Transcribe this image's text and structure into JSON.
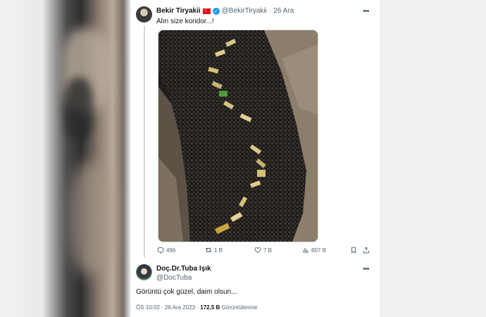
{
  "tweet": {
    "author_name": "Bekir Tiryakii",
    "author_handle": "@BekirTiryakii",
    "separator": "·",
    "date": "26 Ara",
    "text": "Alın size koridor...!",
    "flag_icon": "turkey-flag-icon",
    "verified_icon": "verified-badge-icon",
    "more_label": "•••",
    "stats": {
      "replies": "496",
      "retweets": "1 B",
      "likes": "7 B",
      "views": "807 B"
    }
  },
  "reply": {
    "author_name": "Doç.Dr.Tuba Işık",
    "author_handle": "@DocTuba",
    "more_label": "•••",
    "text": "Görüntü çok güzel, daim olsun...",
    "time": "ÖS 10:02",
    "separator": "·",
    "date": "26 Ara 2023",
    "views_count": "172,5 B",
    "views_label": "Görüntülenme"
  },
  "colors": {
    "text_primary": "#0f1419",
    "text_secondary": "#536471",
    "verified_blue": "#1d9bf0",
    "thread_line": "#cfd9de"
  }
}
